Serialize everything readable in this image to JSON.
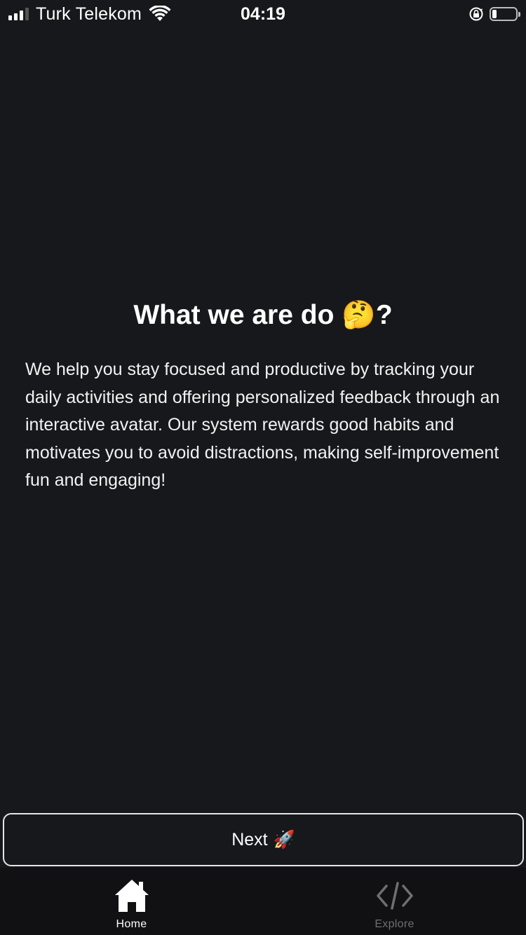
{
  "status_bar": {
    "carrier": "Turk Telekom",
    "time": "04:19",
    "signal_bars": 3,
    "battery_level": 0.2
  },
  "content": {
    "title": "What we are do",
    "title_emoji": "🤔",
    "title_suffix": "?",
    "description": "We help you stay focused and productive by tracking your daily activities and offering personalized feedback through an interactive avatar. Our system rewards good habits and motivates you to avoid distractions, making self-improvement fun and engaging!"
  },
  "next_button": {
    "label": "Next",
    "emoji": "🚀"
  },
  "tab_bar": {
    "tabs": [
      {
        "label": "Home",
        "icon": "home-icon",
        "active": true
      },
      {
        "label": "Explore",
        "icon": "code-icon",
        "active": false
      }
    ]
  },
  "colors": {
    "background": "#17181b",
    "tab_bar_background": "#111113",
    "text": "#ffffff",
    "inactive_tab": "#6f6f73",
    "button_border": "#e6e6e6"
  }
}
